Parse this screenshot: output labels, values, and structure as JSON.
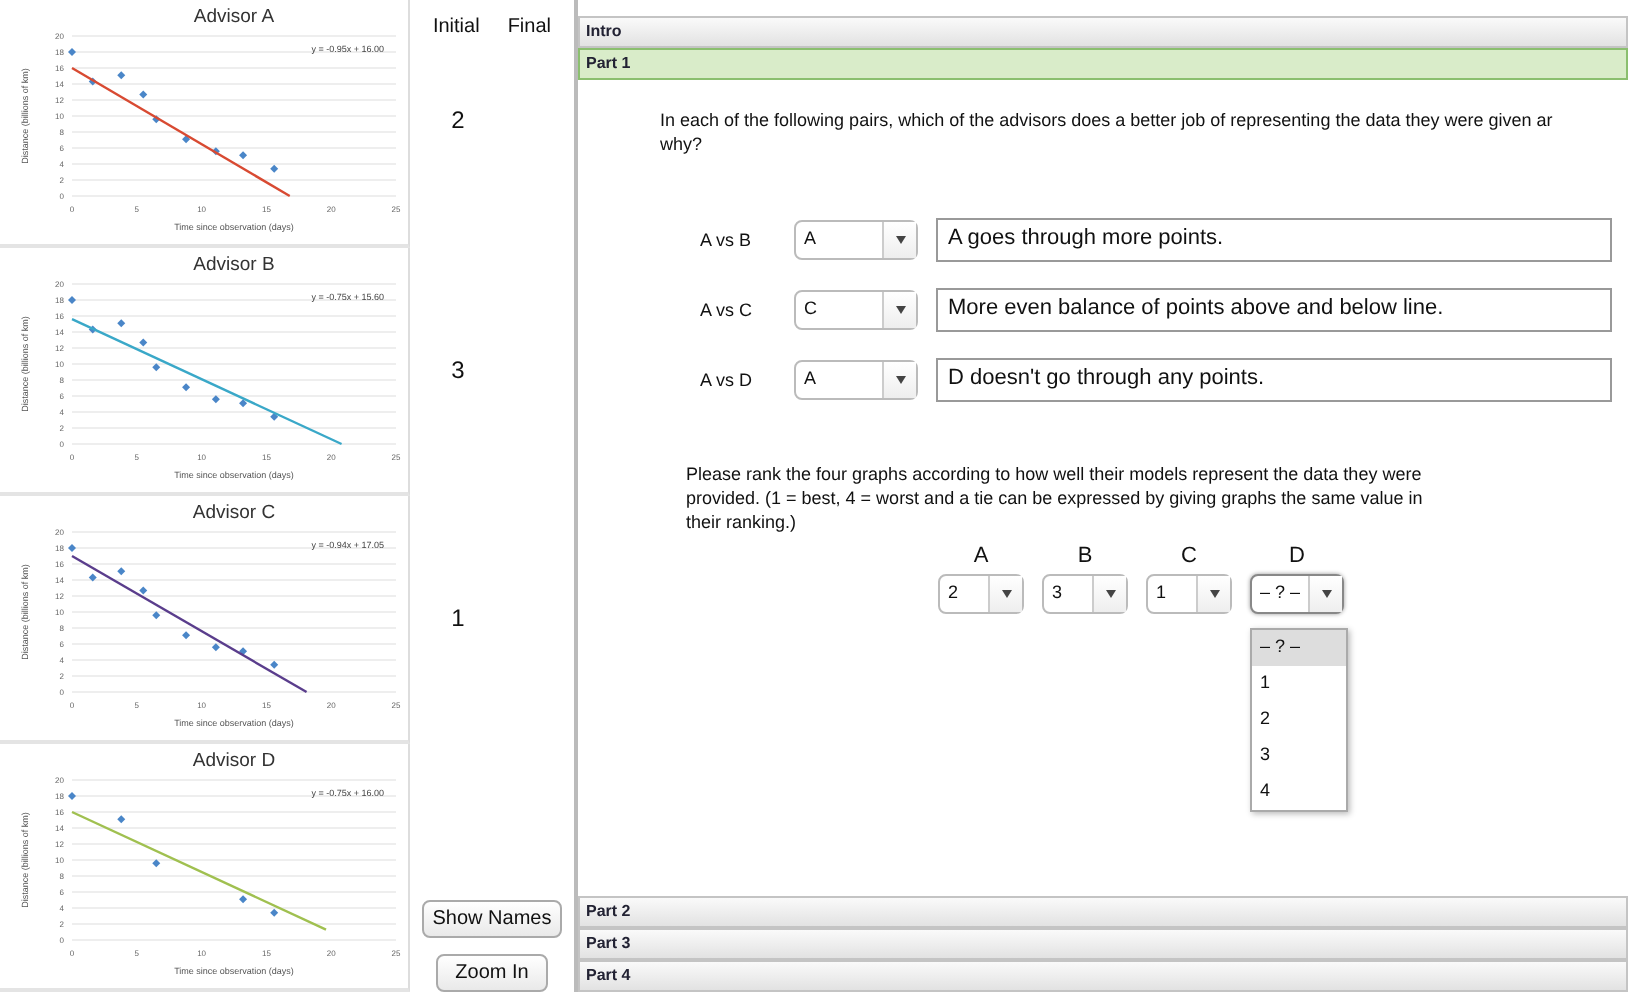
{
  "advisors": [
    {
      "chart_data": {
        "type": "scatter",
        "title": "Advisor A",
        "xlabel": "Time since observation (days)",
        "ylabel": "Distance (billions of km)",
        "xlim": [
          0,
          25
        ],
        "ylim": [
          0,
          20
        ],
        "xticks": [
          0,
          5,
          10,
          15,
          20,
          25
        ],
        "yticks": [
          0,
          2,
          4,
          6,
          8,
          10,
          12,
          14,
          16,
          18,
          20
        ],
        "x": [
          0,
          1.6,
          3.8,
          5.5,
          6.5,
          8.8,
          11.1,
          13.2,
          15.6
        ],
        "grid": true,
        "series": [
          {
            "color": "#4a86c8",
            "values": [
              18,
              14.3,
              15.1,
              12.7,
              9.6,
              7.1,
              5.6,
              5.1,
              3.4
            ]
          },
          {
            "type": "line",
            "color": "#d84a32",
            "x": [
              0,
              16.8
            ],
            "values": [
              16,
              0
            ]
          }
        ],
        "annotations": [
          "y = -0.95x + 16.00"
        ]
      }
    },
    {
      "chart_data": {
        "type": "scatter",
        "title": "Advisor B",
        "xlabel": "Time since observation (days)",
        "ylabel": "Distance (billions of km)",
        "xlim": [
          0,
          25
        ],
        "ylim": [
          0,
          20
        ],
        "xticks": [
          0,
          5,
          10,
          15,
          20,
          25
        ],
        "yticks": [
          0,
          2,
          4,
          6,
          8,
          10,
          12,
          14,
          16,
          18,
          20
        ],
        "x": [
          0,
          1.6,
          3.8,
          5.5,
          6.5,
          8.8,
          11.1,
          13.2,
          15.6
        ],
        "grid": true,
        "series": [
          {
            "color": "#4a86c8",
            "values": [
              18,
              14.3,
              15.1,
              12.7,
              9.6,
              7.1,
              5.6,
              5.1,
              3.4
            ]
          },
          {
            "type": "line",
            "color": "#3aa8c8",
            "x": [
              0,
              20.8
            ],
            "values": [
              15.6,
              0
            ]
          }
        ],
        "annotations": [
          "y = -0.75x + 15.60"
        ]
      }
    },
    {
      "chart_data": {
        "type": "scatter",
        "title": "Advisor C",
        "xlabel": "Time since observation (days)",
        "ylabel": "Distance (billions of km)",
        "xlim": [
          0,
          25
        ],
        "ylim": [
          0,
          20
        ],
        "xticks": [
          0,
          5,
          10,
          15,
          20,
          25
        ],
        "yticks": [
          0,
          2,
          4,
          6,
          8,
          10,
          12,
          14,
          16,
          18,
          20
        ],
        "x": [
          0,
          1.6,
          3.8,
          5.5,
          6.5,
          8.8,
          11.1,
          13.2,
          15.6
        ],
        "grid": true,
        "series": [
          {
            "color": "#4a86c8",
            "values": [
              18,
              14.3,
              15.1,
              12.7,
              9.6,
              7.1,
              5.6,
              5.1,
              3.4
            ]
          },
          {
            "type": "line",
            "color": "#5a3d8c",
            "x": [
              0,
              18.1
            ],
            "values": [
              17,
              0
            ]
          }
        ],
        "annotations": [
          "y = -0.94x + 17.05"
        ]
      }
    },
    {
      "chart_data": {
        "type": "scatter",
        "title": "Advisor D",
        "xlabel": "Time since observation (days)",
        "ylabel": "Distance (billions of km)",
        "xlim": [
          0,
          25
        ],
        "ylim": [
          0,
          20
        ],
        "xticks": [
          0,
          5,
          10,
          15,
          20,
          25
        ],
        "yticks": [
          0,
          2,
          4,
          6,
          8,
          10,
          12,
          14,
          16,
          18,
          20
        ],
        "x": [
          0,
          3.8,
          6.5,
          13.2,
          15.6
        ],
        "grid": true,
        "series": [
          {
            "color": "#4a86c8",
            "values": [
              18,
              15.1,
              9.6,
              5.1,
              3.4
            ]
          },
          {
            "type": "line",
            "color": "#a0c050",
            "x": [
              0,
              19.6
            ],
            "values": [
              16,
              1.3
            ]
          }
        ],
        "annotations": [
          "y = -0.75x + 16.00"
        ]
      }
    }
  ],
  "rank_columns": {
    "initial": "Initial",
    "final": "Final"
  },
  "initial_ranks": [
    "2",
    "3",
    "1"
  ],
  "buttons": [
    "Show Names",
    "Zoom In"
  ],
  "sections_top": [
    {
      "label": "Intro",
      "selected": false
    },
    {
      "label": "Part 1",
      "selected": true
    }
  ],
  "question": [
    "In each of the following pairs, which of the advisors does a better job of representing the data they were given ar",
    "why?"
  ],
  "comparisons": [
    {
      "label": "A vs B",
      "choice": "A",
      "reason": "A goes through more points."
    },
    {
      "label": "A vs C",
      "choice": "C",
      "reason": "More even balance of points above and below line."
    },
    {
      "label": "A vs D",
      "choice": "A",
      "reason": "D doesn't go through any points."
    }
  ],
  "ranking_instructions": [
    "Please rank the four graphs according to how well their models represent the data they were",
    "provided. (1 = best, 4 = worst and a tie can be expressed by giving graphs the same value in",
    "their ranking.)"
  ],
  "rankings": [
    {
      "letter": "A",
      "value": "2",
      "open": false
    },
    {
      "letter": "B",
      "value": "3",
      "open": false
    },
    {
      "letter": "C",
      "value": "1",
      "open": false
    },
    {
      "letter": "D",
      "value": "– ? –",
      "open": true,
      "options": [
        {
          "label": "– ? –",
          "selected": true
        },
        {
          "label": "1",
          "selected": false
        },
        {
          "label": "2",
          "selected": false
        },
        {
          "label": "3",
          "selected": false
        },
        {
          "label": "4",
          "selected": false
        }
      ]
    }
  ],
  "sections_bottom": [
    {
      "label": "Part 2",
      "selected": false
    },
    {
      "label": "Part 3",
      "selected": false
    },
    {
      "label": "Part 4",
      "selected": false
    }
  ]
}
